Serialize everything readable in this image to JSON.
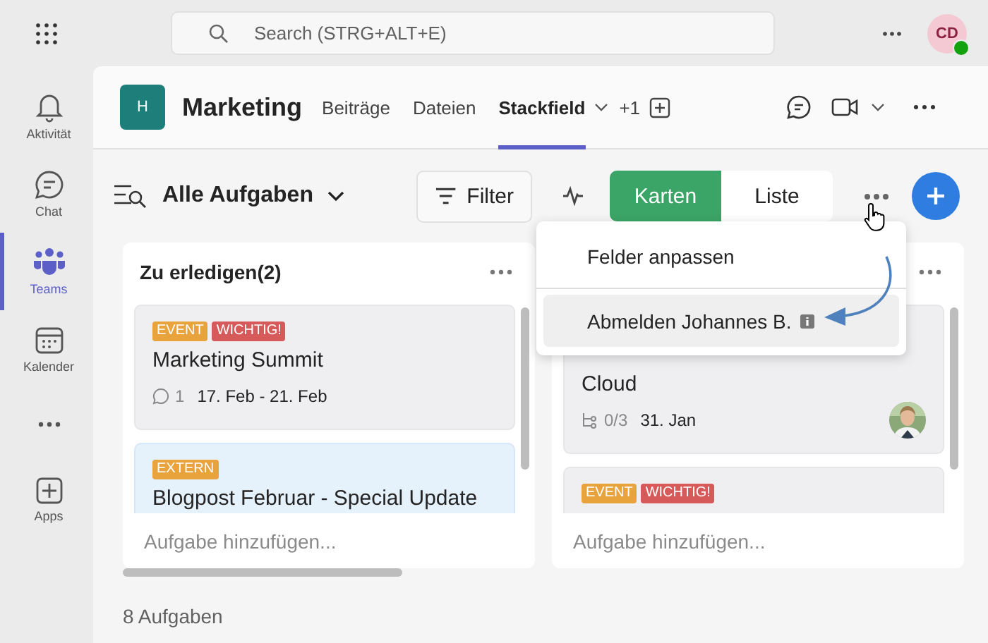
{
  "app_bar": {
    "search_placeholder": "Search (STRG+ALT+E)",
    "avatar": "CD"
  },
  "rail": [
    {
      "label": "Aktivität",
      "selected": false
    },
    {
      "label": "Chat",
      "selected": false
    },
    {
      "label": "Teams",
      "selected": true
    },
    {
      "label": "Kalender",
      "selected": false
    },
    {
      "selected": false
    },
    {
      "label": "Apps",
      "selected": false
    }
  ],
  "channel": {
    "avatar": "H",
    "name": "Marketing",
    "more_tabs": "+1",
    "tabs": [
      {
        "label": "Beiträge",
        "selected": false
      },
      {
        "label": "Dateien",
        "selected": false
      },
      {
        "label": "Stackfield",
        "selected": true
      }
    ]
  },
  "toolbar": {
    "title": "Alle Aufgaben",
    "filter": "Filter",
    "views": [
      {
        "label": "Karten",
        "selected": true
      },
      {
        "label": "Liste",
        "selected": false
      }
    ]
  },
  "menu": {
    "items": [
      {
        "label": "Felder anpassen",
        "highlighted": false
      },
      {
        "label": "Abmelden Johannes B.",
        "highlighted": true
      }
    ]
  },
  "columns": [
    {
      "title": "Zu erledigen(2)",
      "add_placeholder": "Aufgabe hinzufügen...",
      "cards": [
        {
          "tags": [
            {
              "label": "EVENT",
              "color": "#e8a33d"
            },
            {
              "label": "WICHTIG!",
              "color": "#d75a5a"
            }
          ],
          "title": "Marketing Summit",
          "comments": "1",
          "date": "17. Feb - 21. Feb",
          "selected": false
        },
        {
          "tags": [
            {
              "label": "EXTERN",
              "color": "#e8a33d"
            }
          ],
          "title": "Blogpost Februar - Special Update",
          "selected": true
        }
      ]
    },
    {
      "add_placeholder": "Aufgabe hinzufügen...",
      "cards": [
        {
          "title": "Cloud",
          "subtasks": "0/3",
          "date": "31. Jan",
          "selected": false
        },
        {
          "tags": [
            {
              "label": "EVENT",
              "color": "#e8a33d"
            },
            {
              "label": "WICHTIG!",
              "color": "#d75a5a"
            }
          ],
          "selected": false
        }
      ]
    }
  ],
  "footer": "8 Aufgaben"
}
